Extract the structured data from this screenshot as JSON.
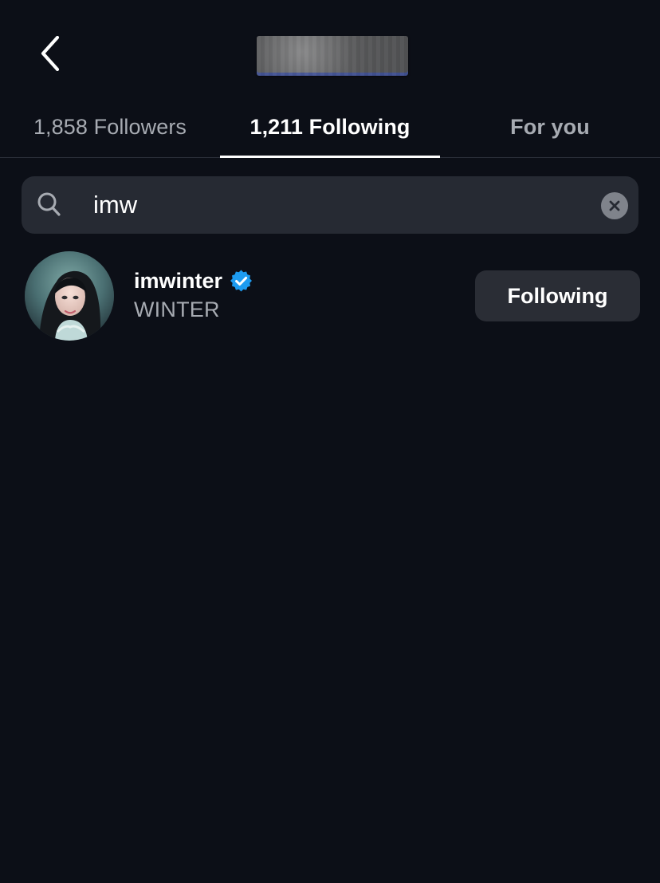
{
  "header": {
    "title": "",
    "back_icon": "chevron-left-icon"
  },
  "tabs": [
    {
      "label": "1,858 Followers"
    },
    {
      "label": "1,211 Following",
      "active": true
    },
    {
      "label": "For you"
    }
  ],
  "search": {
    "value": "imw",
    "placeholder": "",
    "search_icon": "search-icon",
    "clear_icon": "close-circle-icon"
  },
  "results": [
    {
      "username": "imwinter",
      "display_name": "WINTER",
      "verified": true,
      "button_label": "Following"
    }
  ],
  "colors": {
    "background": "#0c0f17",
    "search_bar": "#262a33",
    "button_bg": "#2a2d35",
    "verified_blue": "#1d9bf0",
    "muted_text": "#a7abb2"
  }
}
